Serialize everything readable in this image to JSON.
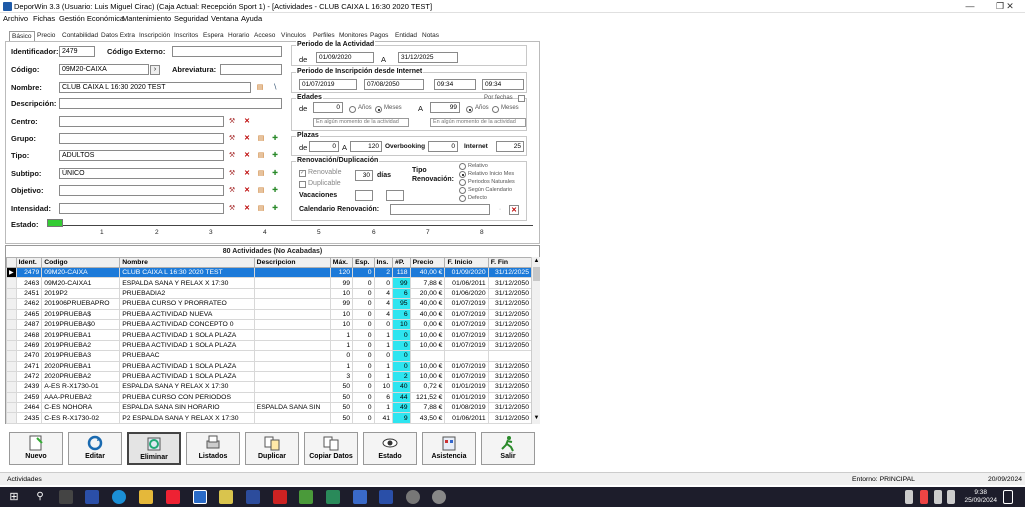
{
  "window": {
    "title": "DeporWin 3.3  (Usuario: Luis Miguel Cirac)  (Caja Actual: Recepción Sport 1)  - [Actividades - CLUB CAIXA L 16:30 2020 TEST]"
  },
  "menu": [
    "Archivo",
    "Fichas",
    "Gestión Económica",
    "Mantenimiento",
    "Seguridad",
    "Ventana",
    "Ayuda"
  ],
  "tabs": [
    "Básico",
    "Precio",
    "Contabilidad",
    "Datos Extra",
    "Inscripción",
    "Inscritos",
    "Espera",
    "Horario",
    "Acceso",
    "Vínculos",
    "Perfiles",
    "Monitores",
    "Pagos",
    "Entidad",
    "Notas"
  ],
  "form": {
    "identificador_label": "Identificador:",
    "identificador": "2479",
    "codigo_externo_label": "Código Externo:",
    "codigo_label": "Código:",
    "codigo": "09M20-CAIXA",
    "abreviatura_label": "Abreviatura:",
    "nombre_label": "Nombre:",
    "nombre": "CLUB CAIXA L 16:30 2020 TEST",
    "descripcion_label": "Descripción:",
    "centro_label": "Centro:",
    "grupo_label": "Grupo:",
    "tipo_label": "Tipo:",
    "tipo": "ADULTOS",
    "subtipo_label": "Subtipo:",
    "subtipo": "ÚNICO",
    "objetivo_label": "Objetivo:",
    "intensidad_label": "Intensidad:",
    "estado_label": "Estado:",
    "ruler": [
      "1",
      "2",
      "3",
      "4",
      "5",
      "6",
      "7",
      "8"
    ]
  },
  "periodo": {
    "label": "Periodo de la Actividad",
    "de": "de",
    "a": "A",
    "from": "01/09/2020",
    "to": "31/12/2025"
  },
  "inscripcion": {
    "label": "Periodo de Inscripción desde Internet",
    "from": "01/07/2019",
    "to": "07/08/2050",
    "t1": "09:34",
    "t2": "09:34"
  },
  "edades": {
    "label": "Edades",
    "de": "de",
    "de_value": "0",
    "anos": "Años",
    "meses": "Meses",
    "a": "A",
    "a_value": "99",
    "anos2": "Años",
    "meses2": "Meses",
    "por_fechas": "Por fechas",
    "momento1": "En algún momento de la actividad",
    "momento2": "En algún momento de la actividad"
  },
  "plazas": {
    "label": "Plazas",
    "de": "de",
    "de_value": "0",
    "a": "A",
    "a_value": "120",
    "overbooking": "Overbooking",
    "overbooking_value": "0",
    "internet": "Internet",
    "internet_value": "25"
  },
  "renovacion": {
    "label": "Renovación/Duplicación",
    "renovable": "Renovable",
    "duplicable": "Duplicable",
    "dias_value": "30",
    "dias": "días",
    "tipo_label": "Tipo\nRenovación:",
    "vacaciones": "Vacaciones",
    "calendario": "Calendario Renovación:",
    "opciones": [
      "Relativo",
      "Relativo Inicio Mes",
      "Periodos Naturales",
      "Según Calendario",
      "Defecto"
    ]
  },
  "grid": {
    "title": "80 Actividades  (No Acabadas)",
    "columns": [
      "Ident.",
      "Codigo",
      "Nombre",
      "Descripcion",
      "Máx.",
      "Esp.",
      "Ins.",
      "#P.",
      "Precio",
      "F. Inicio",
      "F. Fin"
    ],
    "rows": [
      [
        "2479",
        "09M20-CAIXA",
        "CLUB CAIXA L 16:30 2020 TEST",
        "",
        "120",
        "0",
        "2",
        "118",
        "40,00 €",
        "01/09/2020",
        "31/12/2025"
      ],
      [
        "2463",
        "09M20-CAIXA1",
        "ESPALDA SANA Y RELAX X 17:30",
        "",
        "99",
        "0",
        "0",
        "99",
        "7,88 €",
        "01/06/2011",
        "31/12/2050"
      ],
      [
        "2451",
        "2019P2",
        "PRUEBADIA2",
        "",
        "10",
        "0",
        "4",
        "6",
        "20,00 €",
        "01/06/2020",
        "31/12/2050"
      ],
      [
        "2462",
        "201906PRUEBAPRO",
        "PRUEBA CURSO Y PRORRATEO",
        "",
        "99",
        "0",
        "4",
        "95",
        "40,00 €",
        "01/07/2019",
        "31/12/2050"
      ],
      [
        "2465",
        "2019PRUEBA$",
        "PRUEBA ACTIVIDAD NUEVA",
        "",
        "10",
        "0",
        "4",
        "6",
        "40,00 €",
        "01/07/2019",
        "31/12/2050"
      ],
      [
        "2487",
        "2019PRUEBA$0",
        "PRUEBA ACTIVIDAD CONCEPTO 0",
        "",
        "10",
        "0",
        "0",
        "10",
        "0,00 €",
        "01/07/2019",
        "31/12/2050"
      ],
      [
        "2468",
        "2019PRUEBA1",
        "PRUEBA ACTIVIDAD 1 SOLA PLAZA",
        "",
        "1",
        "0",
        "1",
        "0",
        "10,00 €",
        "01/07/2019",
        "31/12/2050"
      ],
      [
        "2469",
        "2019PRUEBA2",
        "PRUEBA ACTIVIDAD 1 SOLA PLAZA",
        "",
        "1",
        "0",
        "1",
        "0",
        "10,00 €",
        "01/07/2019",
        "31/12/2050"
      ],
      [
        "2470",
        "2019PRUEBA3",
        "PRUEBAAC",
        "",
        "0",
        "0",
        "0",
        "0",
        "",
        "",
        ""
      ],
      [
        "2471",
        "2020PRUEBA1",
        "PRUEBA ACTIVIDAD 1 SOLA PLAZA",
        "",
        "1",
        "0",
        "1",
        "0",
        "10,00 €",
        "01/07/2019",
        "31/12/2050"
      ],
      [
        "2472",
        "2020PRUEBA2",
        "PRUEBA ACTIVIDAD 1 SOLA PLAZA",
        "",
        "3",
        "0",
        "1",
        "2",
        "10,00 €",
        "01/07/2019",
        "31/12/2050"
      ],
      [
        "2439",
        "A-ES R-X1730-01",
        "ESPALDA SANA Y RELAX X 17:30",
        "",
        "50",
        "0",
        "10",
        "40",
        "0,72 €",
        "01/01/2019",
        "31/12/2050"
      ],
      [
        "2459",
        "AAA-PRUEBA2",
        "PRUEBA CURSO CON PERIODOS",
        "",
        "50",
        "0",
        "6",
        "44",
        "121,52 €",
        "01/01/2019",
        "31/12/2050"
      ],
      [
        "2464",
        "C-ES NOHORA",
        "ESPALDA SANA SIN HORARIO",
        "ESPALDA SANA SIN",
        "50",
        "0",
        "1",
        "49",
        "7,88 €",
        "01/08/2019",
        "31/12/2050"
      ],
      [
        "2435",
        "C-ES R-X1730-02",
        "P2  ESPALDA SANA Y RELAX X 17:30",
        "",
        "50",
        "0",
        "41",
        "9",
        "43,50 €",
        "01/06/2011",
        "31/12/2050"
      ]
    ]
  },
  "toolbar": [
    "Nuevo",
    "Editar",
    "Eliminar",
    "Listados",
    "Duplicar",
    "Copiar Datos",
    "Estado",
    "Asistencia",
    "Salir"
  ],
  "status": {
    "left": "Actividades",
    "entorno": "Entorno: PRINCIPAL",
    "date": "20/09/2024"
  },
  "clock": {
    "time": "9:38",
    "date": "25/09/2024"
  }
}
